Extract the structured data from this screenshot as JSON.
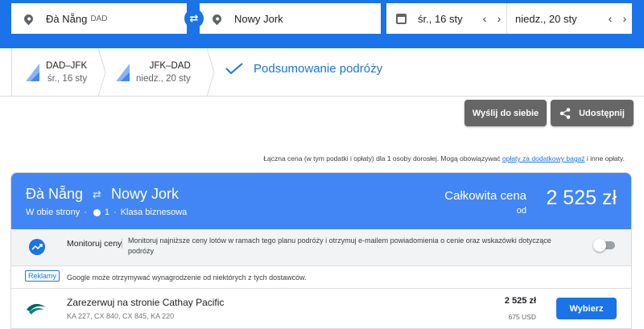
{
  "search": {
    "origin_city": "Đà Nẵng",
    "origin_code": "DAD",
    "destination_city": "Nowy Jork",
    "depart_date": "śr., 16 sty",
    "return_date": "niedz., 20 sty",
    "prev_symbol": "‹",
    "next_symbol": "›",
    "swap_symbol": "⇄"
  },
  "steps": [
    {
      "route": "DAD–JFK",
      "date": "śr., 16 sty"
    },
    {
      "route": "JFK–DAD",
      "date": "niedz., 20 sty"
    }
  ],
  "summary_step": "Podsumowanie podróży",
  "actions": {
    "send_label": "Wyślij do siebie",
    "share_label": "Udostępnij"
  },
  "price_note": {
    "before": "Łączna cena (w tym podatki i opłaty) dla 1 osoby dorosłej. Mogą obowiązywać ",
    "link": "opłaty za dodatkowy bagaż",
    "after": " i inne opłaty."
  },
  "trip": {
    "from": "Đà Nẵng",
    "to": "Nowy Jork",
    "arrows": "⇄",
    "type": "W obie strony",
    "separator": "·",
    "passengers": "1",
    "cabin": "Klasa biznesowa",
    "total_label": "Całkowita cena",
    "from_label": "od",
    "total_price": "2 525 zł"
  },
  "monitor": {
    "title": "Monitoruj ceny",
    "description": "Monitoruj najniższe ceny lotów w ramach tego planu podróży i otrzymuj e-mailem powiadomienia o cenie oraz wskazówki dotyczące podróży"
  },
  "ads": {
    "badge": "Reklamy",
    "text": "Google może otrzymywać wynagrodzenie od niektórych z tych dostawców."
  },
  "booking": {
    "title": "Zarezerwuj na stronie Cathay Pacific",
    "flights": "KA 227, CX 840, CX 845, KA 220",
    "price": "2 525 zł",
    "price_usd": "675 USD",
    "button": "Wybierz"
  },
  "icons": {
    "pin": "location-pin-icon",
    "calendar": "calendar-icon",
    "tail": "airline-tail-icon",
    "check": "checkmark-icon",
    "share": "share-icon",
    "trend": "trending-icon",
    "logo": "cathay-pacific-logo"
  },
  "colors": {
    "brand_blue": "#1a73e8",
    "card_header": "#4285f4",
    "button_grey": "#666666",
    "monitor_bg": "#f1f3f4"
  }
}
